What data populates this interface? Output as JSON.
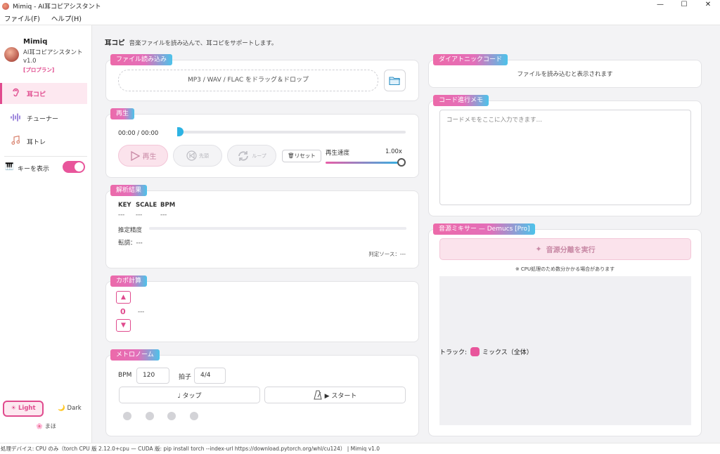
{
  "window": {
    "title": "Mimiq - AI耳コピアシスタント",
    "min": "—",
    "max": "☐",
    "close": "✕"
  },
  "menu": {
    "file": "ファイル(F)",
    "help": "ヘルプ(H)"
  },
  "profile": {
    "name": "Mimiq",
    "subtitle": "AI耳コピアシスタント",
    "version": "v1.0",
    "plan": "[プロプラン]"
  },
  "nav": [
    {
      "label": "耳コピ",
      "icon": "ear-icon"
    },
    {
      "label": "チューナー",
      "icon": "waveform-icon"
    },
    {
      "label": "耳トレ",
      "icon": "music-note-icon"
    }
  ],
  "key_toggle": {
    "label": "キーを表示",
    "on": true
  },
  "theme": {
    "light": "☀ Light",
    "dark": "🌙 Dark"
  },
  "mascot": "🌸 まほ",
  "page": {
    "title": "耳コピ",
    "description": "音楽ファイルを読み込んで、耳コピをサポートします。"
  },
  "file_card": {
    "chip": "ファイル読み込み",
    "drop_text": "MP3 / WAV / FLAC をドラッグ＆ドロップ"
  },
  "playback": {
    "chip": "再生",
    "time": "00:00 / 00:00",
    "play": "再生",
    "head": "先頭",
    "loop": "ループ",
    "reset": "🗑リセット",
    "speed_label": "再生速度",
    "speed_value": "1.00x",
    "progress": 0
  },
  "analysis": {
    "chip": "解析結果",
    "headers": [
      "KEY",
      "SCALE",
      "BPM"
    ],
    "values": [
      "---",
      "---",
      "---"
    ],
    "precision_label": "推定精度",
    "transpose": "転調：---",
    "source": "判定ソース：---"
  },
  "capo": {
    "chip": "カポ計算",
    "up": "▲",
    "value": "0",
    "down": "▼",
    "result": "---"
  },
  "metronome": {
    "chip": "メトロノーム",
    "bpm_label": "BPM",
    "bpm_value": "120",
    "beat_label": "拍子",
    "beat_value": "4/4",
    "tap": "♩ タップ",
    "start": "▶ スタート"
  },
  "diatonic": {
    "chip": "ダイアトニックコード",
    "hint": "ファイルを読み込むと表示されます"
  },
  "memo": {
    "chip": "コード進行メモ",
    "placeholder": "コードメモをここに入力できます…"
  },
  "mixer": {
    "chip": "音源ミキサー — Demucs [Pro]",
    "button": "音源分離を実行",
    "note": "※ CPU処理のため数分かかる場合があります",
    "track_label": "トラック:",
    "track_name": "ミックス（全体）"
  },
  "status": "処理デバイス: CPU のみ（torch CPU 版 2.12.0+cpu — CUDA 版: pip install torch --index-url https://download.pytorch.org/whl/cu124） | Mimiq v1.0",
  "colors": {
    "accent": "#e04b8e",
    "accent_light": "#fde8f0",
    "cyan": "#2db3e3"
  }
}
